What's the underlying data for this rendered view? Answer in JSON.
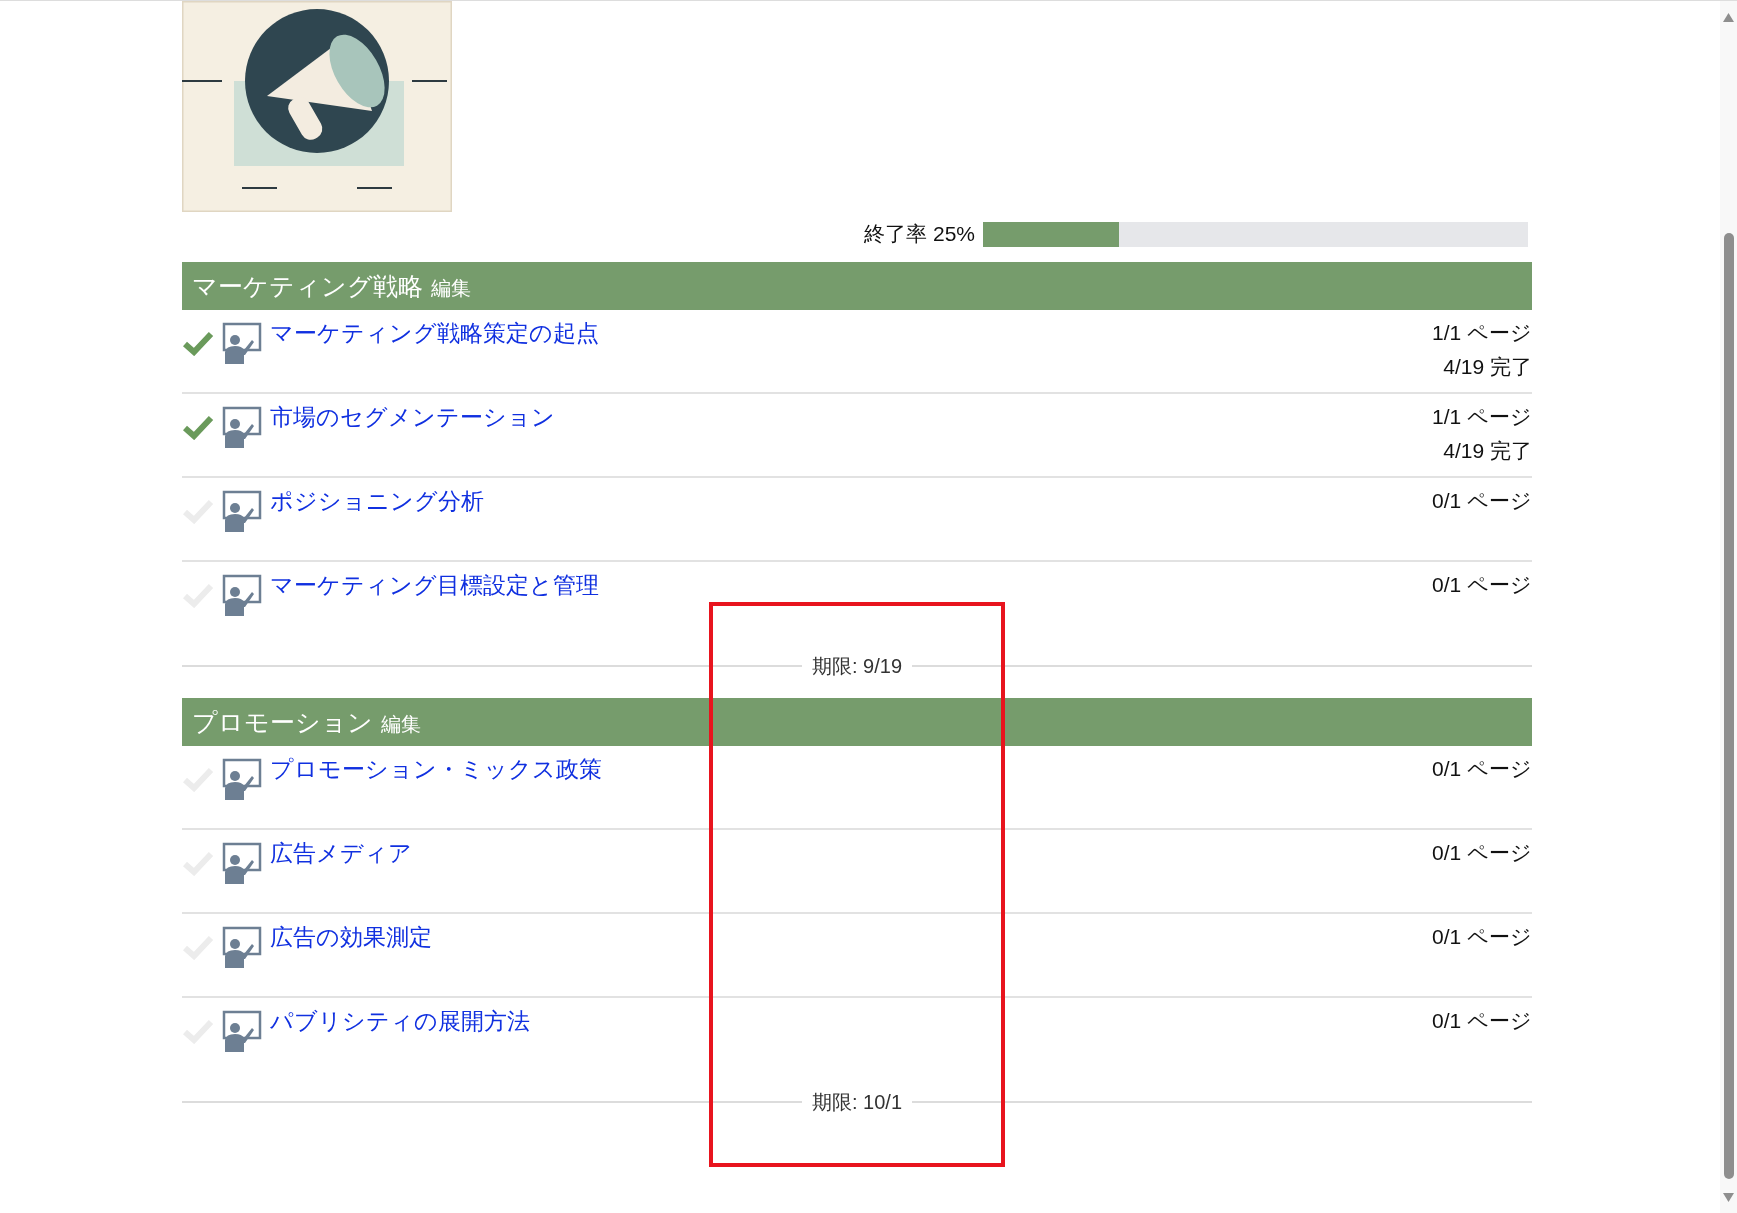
{
  "progress": {
    "label": "終了率 25%",
    "level": 0.25
  },
  "sections": [
    {
      "title": "マーケティング戦略",
      "edit": "編集",
      "lessons": [
        {
          "title": "マーケティング戦略策定の起点",
          "completed": true,
          "pages": "1/1 ページ",
          "done_date": "4/19 完了"
        },
        {
          "title": "市場のセグメンテーション",
          "completed": true,
          "pages": "1/1 ページ",
          "done_date": "4/19 完了"
        },
        {
          "title": "ポジショニング分析",
          "completed": false,
          "pages": "0/1 ページ"
        },
        {
          "title": "マーケティング目標設定と管理",
          "completed": false,
          "pages": "0/1 ページ"
        }
      ],
      "deadline": "期限: 9/19"
    },
    {
      "title": "プロモーション",
      "edit": "編集",
      "lessons": [
        {
          "title": "プロモーション・ミックス政策",
          "completed": false,
          "pages": "0/1 ページ"
        },
        {
          "title": "広告メディア",
          "completed": false,
          "pages": "0/1 ページ"
        },
        {
          "title": "広告の効果測定",
          "completed": false,
          "pages": "0/1 ページ"
        },
        {
          "title": "パブリシティの展開方法",
          "completed": false,
          "pages": "0/1 ページ"
        }
      ],
      "deadline": "期限: 10/1"
    }
  ]
}
